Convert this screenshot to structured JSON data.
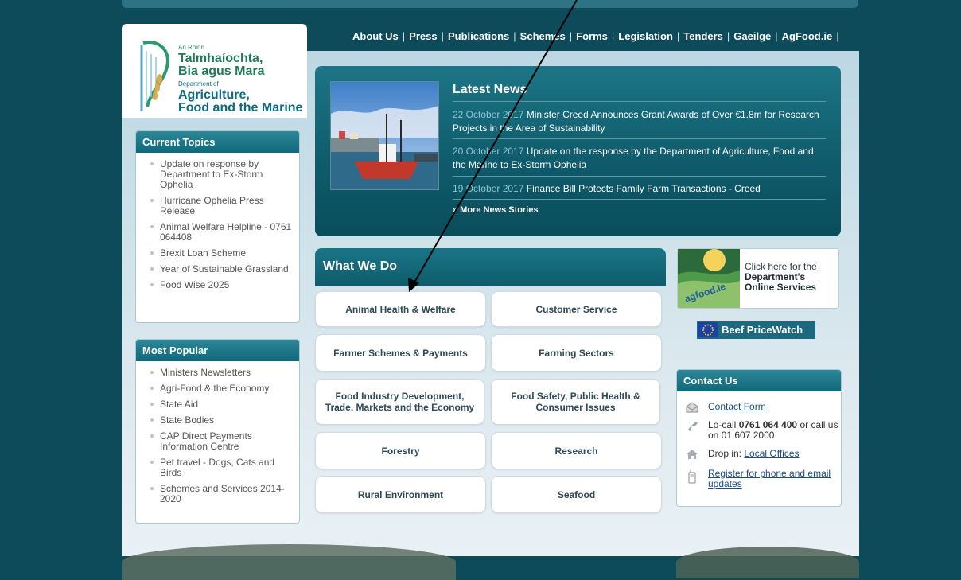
{
  "nav": {
    "items": [
      "About Us",
      "Press",
      "Publications",
      "Schemes",
      "Forms",
      "Legislation",
      "Tenders",
      "Gaeilge",
      "AgFood.ie"
    ]
  },
  "logo": {
    "line1_small": "An Roinn",
    "line2": "Talmhaíochta,",
    "line3": "Bia agus Mara",
    "line4_small": "Department of",
    "line5": "Agriculture,",
    "line6": "Food and the Marine"
  },
  "current_topics": {
    "title": "Current Topics",
    "items": [
      "Update on response by Department to Ex-Storm Ophelia",
      "Hurricane Ophelia Press Release",
      "Animal Welfare Helpline - 0761 064408",
      "Brexit Loan Scheme",
      "Year of Sustainable Grassland",
      "Food Wise 2025"
    ]
  },
  "most_popular": {
    "title": "Most Popular",
    "items": [
      "Ministers Newsletters",
      "Agri-Food & the Economy",
      "State Aid",
      "State Bodies",
      "CAP Direct Payments Information Centre",
      "Pet travel - Dogs, Cats and Birds",
      "Schemes and Services 2014-2020"
    ]
  },
  "news": {
    "title": "Latest News",
    "items": [
      {
        "date": "22 October 2017",
        "text": "Minister Creed Announces Grant Awards of Over €1.8m for Research Projects in the Area of Sustainability"
      },
      {
        "date": "20 October 2017",
        "text": "Update on the response by the Department of Agriculture, Food and the Marine to Ex-Storm Ophelia"
      },
      {
        "date": "19 October 2017",
        "text": "Finance Bill Protects Family Farm Transactions - Creed"
      }
    ],
    "more": "» More News Stories"
  },
  "what_we_do": {
    "title": "What We Do",
    "buttons": [
      "Animal Health & Welfare",
      "Customer Service",
      "Farmer Schemes & Payments",
      "Farming Sectors",
      "Food Industry Development, Trade, Markets and the Economy",
      "Food Safety, Public Health & Consumer Issues",
      "Forestry",
      "Research",
      "Rural Environment",
      "Seafood"
    ]
  },
  "agfood": {
    "logo_text": "agfood.ie",
    "line1": "Click here for the",
    "line2": "Department's",
    "line3": "Online Services"
  },
  "beef": {
    "label": "Beef PriceWatch"
  },
  "contact": {
    "title": "Contact Us",
    "form_link": "Contact Form",
    "locall_prefix": "Lo-call",
    "locall_number": "0761 064 400",
    "locall_suffix": "or call us on 01 607 2000",
    "dropin_prefix": "Drop in:",
    "dropin_link": "Local Offices",
    "register_link": "Register for phone and email updates"
  },
  "colors": {
    "background": "#0d4a5a",
    "accent": "#106879",
    "link": "#1a4e86"
  }
}
